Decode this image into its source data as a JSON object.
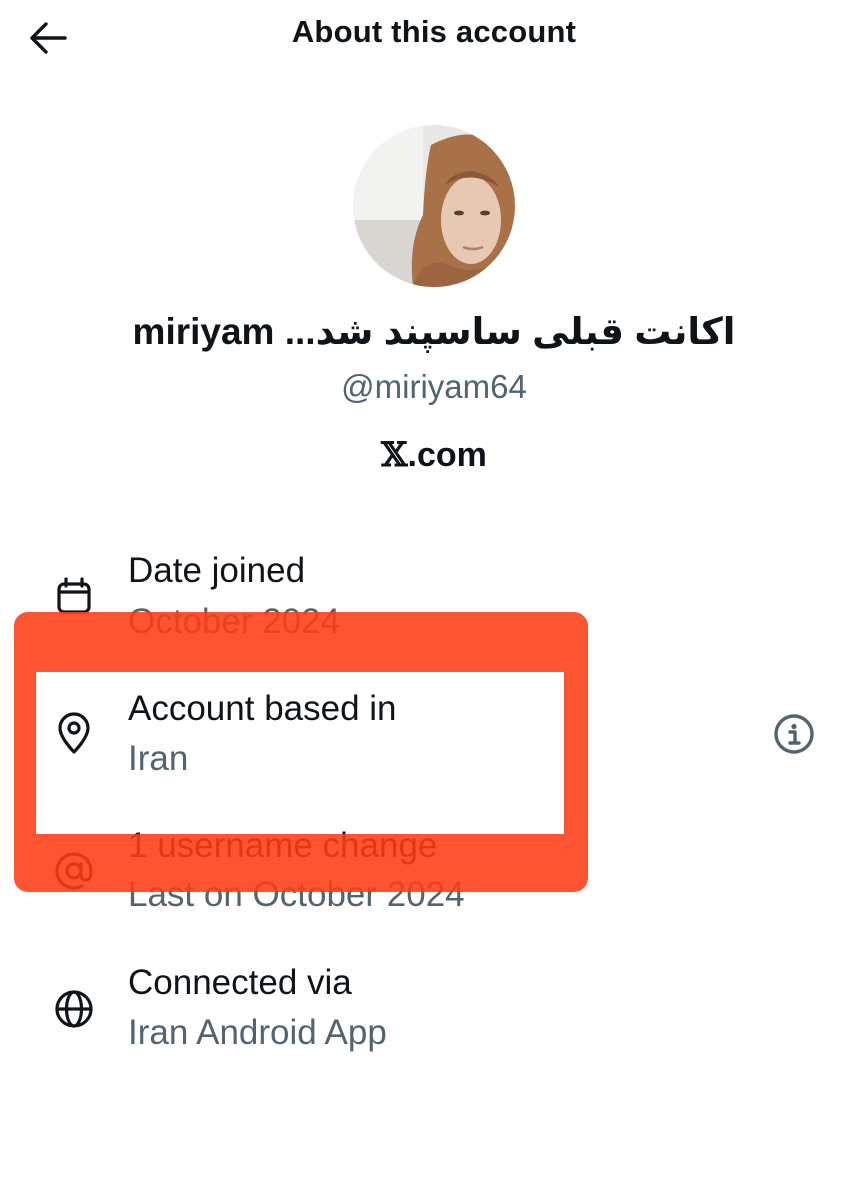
{
  "header": {
    "title": "About this account",
    "back_icon": "arrow-left-icon"
  },
  "profile": {
    "display_name": "اکانت قبلی ساسپند شد... miriyam",
    "handle": "@miriyam64",
    "platform_logo": "𝕏",
    "platform_suffix": ".com"
  },
  "rows": [
    {
      "icon": "calendar-icon",
      "label": "Date joined",
      "value": "October 2024"
    },
    {
      "icon": "location-pin-icon",
      "label": "Account based in",
      "value": "Iran",
      "trailing_icon": "info-icon"
    },
    {
      "icon": "at-sign-icon",
      "label": "1 username change",
      "value": "Last on October 2024"
    },
    {
      "icon": "globe-icon",
      "label": "Connected via",
      "value": "Iran Android App"
    }
  ],
  "colors": {
    "text_primary": "#0f1419",
    "text_secondary": "#536471",
    "highlight": "#ff3c14"
  }
}
